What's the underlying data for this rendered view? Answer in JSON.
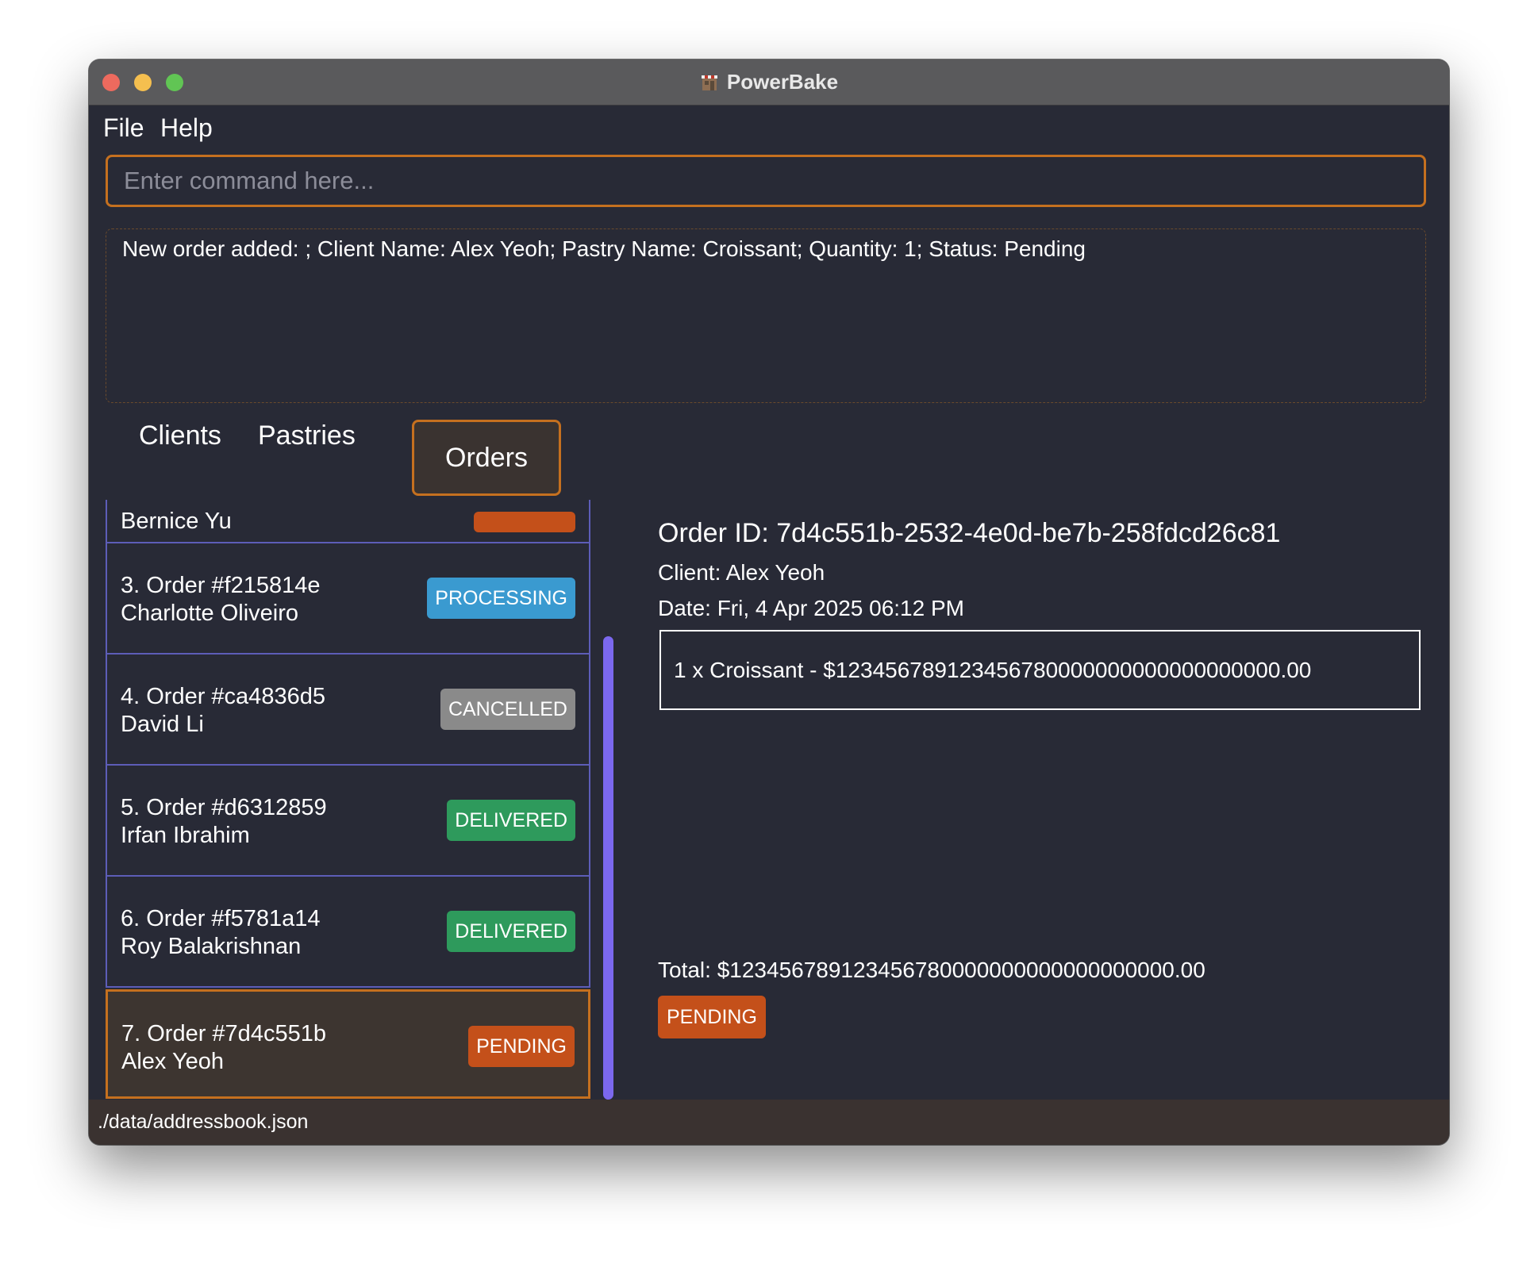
{
  "window": {
    "title": "PowerBake"
  },
  "menu": {
    "file": "File",
    "help": "Help"
  },
  "command": {
    "placeholder": "Enter command here...",
    "value": ""
  },
  "result": {
    "message": "New order added: ; Client Name: Alex Yeoh; Pastry Name: Croissant; Quantity: 1; Status: Pending"
  },
  "tabs": {
    "clients": "Clients",
    "pastries": "Pastries",
    "orders": "Orders",
    "active": "Orders"
  },
  "status_colors": {
    "PENDING": "#c4501a",
    "PROCESSING": "#3a9ad0",
    "CANCELLED": "#8a8a8a",
    "DELIVERED": "#2e9a5c"
  },
  "orders": [
    {
      "title": "",
      "client": "Bernice Yu",
      "status": ""
    },
    {
      "title": "3. Order #f215814e",
      "client": "Charlotte Oliveiro",
      "status": "PROCESSING"
    },
    {
      "title": "4. Order #ca4836d5",
      "client": "David Li",
      "status": "CANCELLED"
    },
    {
      "title": "5. Order #d6312859",
      "client": "Irfan Ibrahim",
      "status": "DELIVERED"
    },
    {
      "title": "6. Order #f5781a14",
      "client": "Roy Balakrishnan",
      "status": "DELIVERED"
    },
    {
      "title": "7. Order #7d4c551b",
      "client": "Alex Yeoh",
      "status": "PENDING"
    }
  ],
  "detail": {
    "order_id": "Order ID: 7d4c551b-2532-4e0d-be7b-258fdcd26c81",
    "client": "Client: Alex Yeoh",
    "date": "Date: Fri, 4 Apr 2025 06:12 PM",
    "items": [
      "1 x Croissant - $123456789123456780000000000000000000.00"
    ],
    "total": "Total: $123456789123456780000000000000000000.00",
    "status": "PENDING"
  },
  "statusbar": {
    "path": "./data/addressbook.json"
  }
}
